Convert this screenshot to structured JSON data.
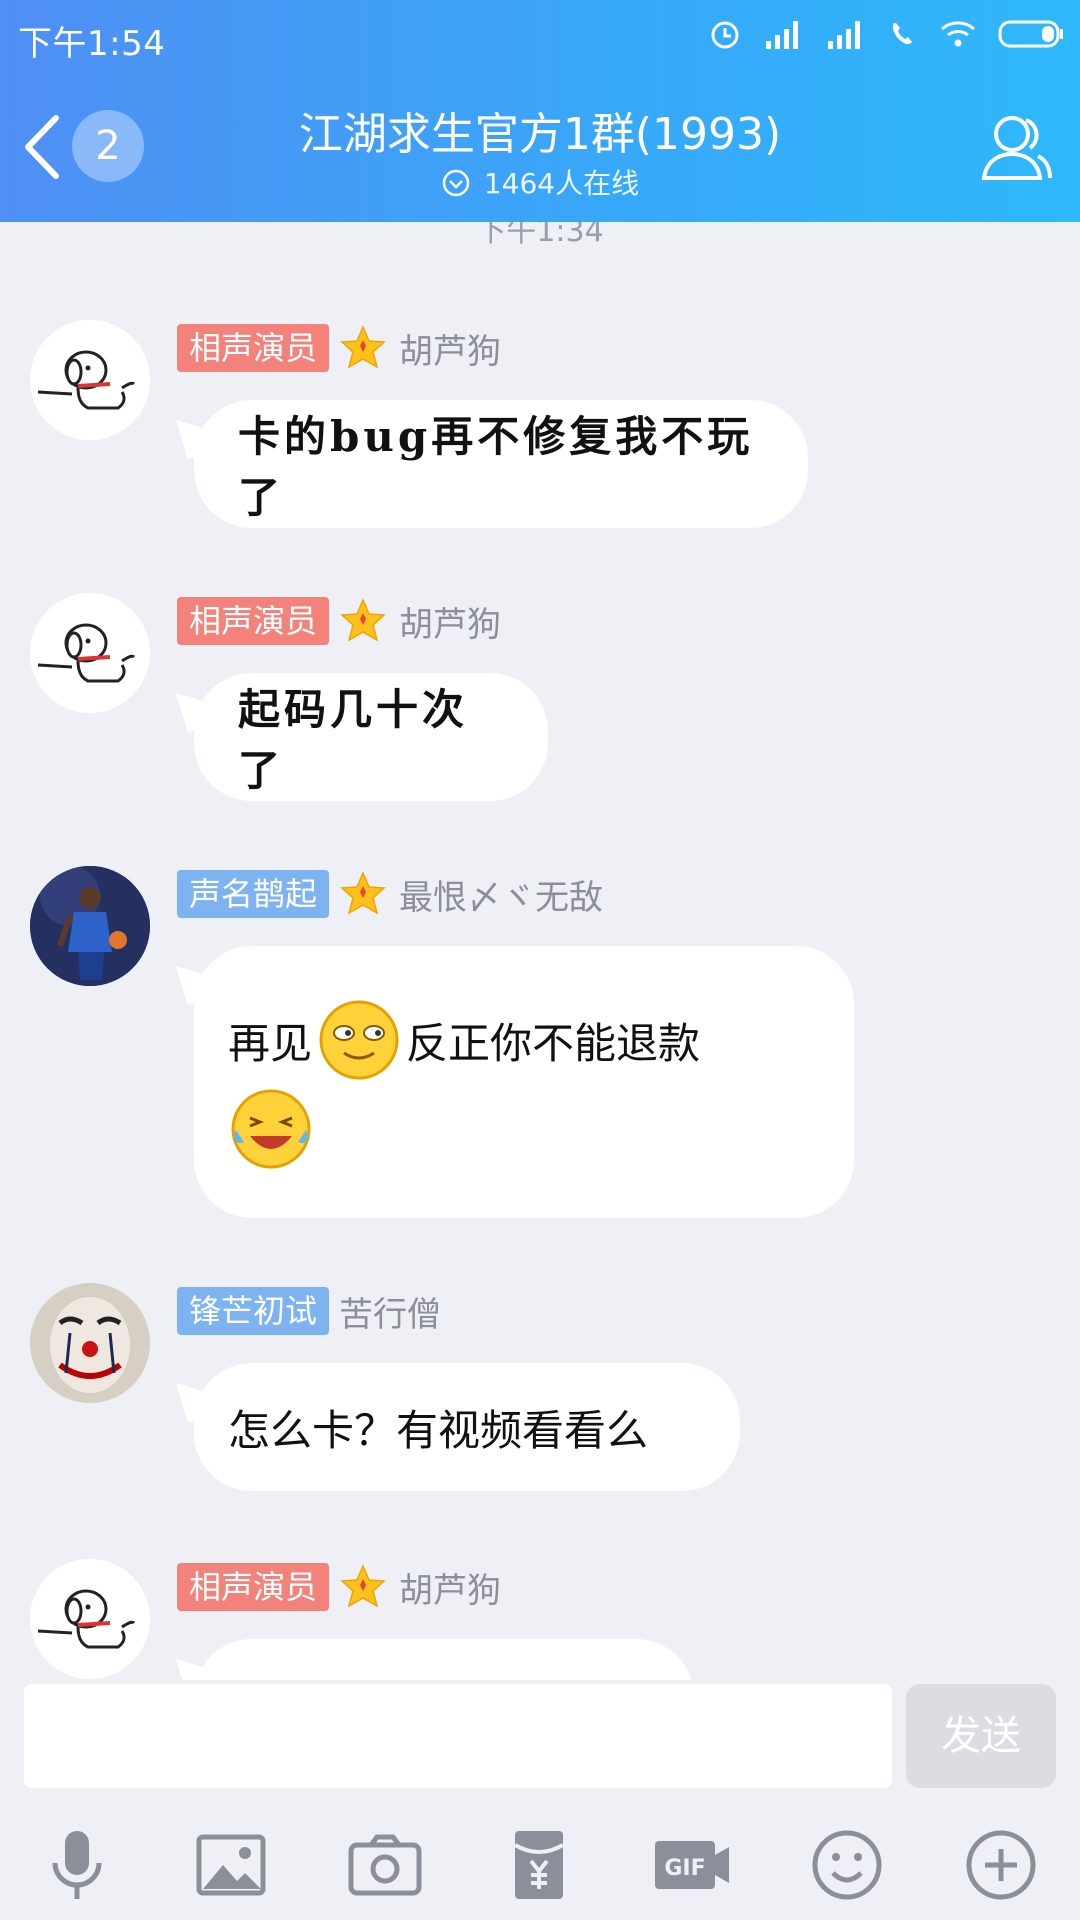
{
  "status": {
    "time": "下午1:54"
  },
  "header": {
    "unread_count": "2",
    "title": "江湖求生官方1群(1993)",
    "online": "1464人在线"
  },
  "chat": {
    "timestamp": "下午1:34",
    "messages": [
      {
        "tag": "相声演员",
        "name": "胡芦狗",
        "text": "卡的bug再不修复我不玩了"
      },
      {
        "tag": "相声演员",
        "name": "胡芦狗",
        "text": "起码几十次了"
      },
      {
        "tag": "声名鹊起",
        "name": "最恨〆ヾ无敌",
        "text_a": "再见",
        "text_b": "反正你不能退款"
      },
      {
        "tag": "锋芒初试",
        "name": "苦行僧",
        "text": "怎么卡？有视频看看么"
      },
      {
        "tag": "相声演员",
        "name": "胡芦狗"
      }
    ]
  },
  "input": {
    "send_label": "发送"
  },
  "colors": {
    "header_start": "#4f8ff3",
    "header_end": "#2fb8fb",
    "tag_red": "#f2827a",
    "tag_blue": "#7eb3f2"
  }
}
